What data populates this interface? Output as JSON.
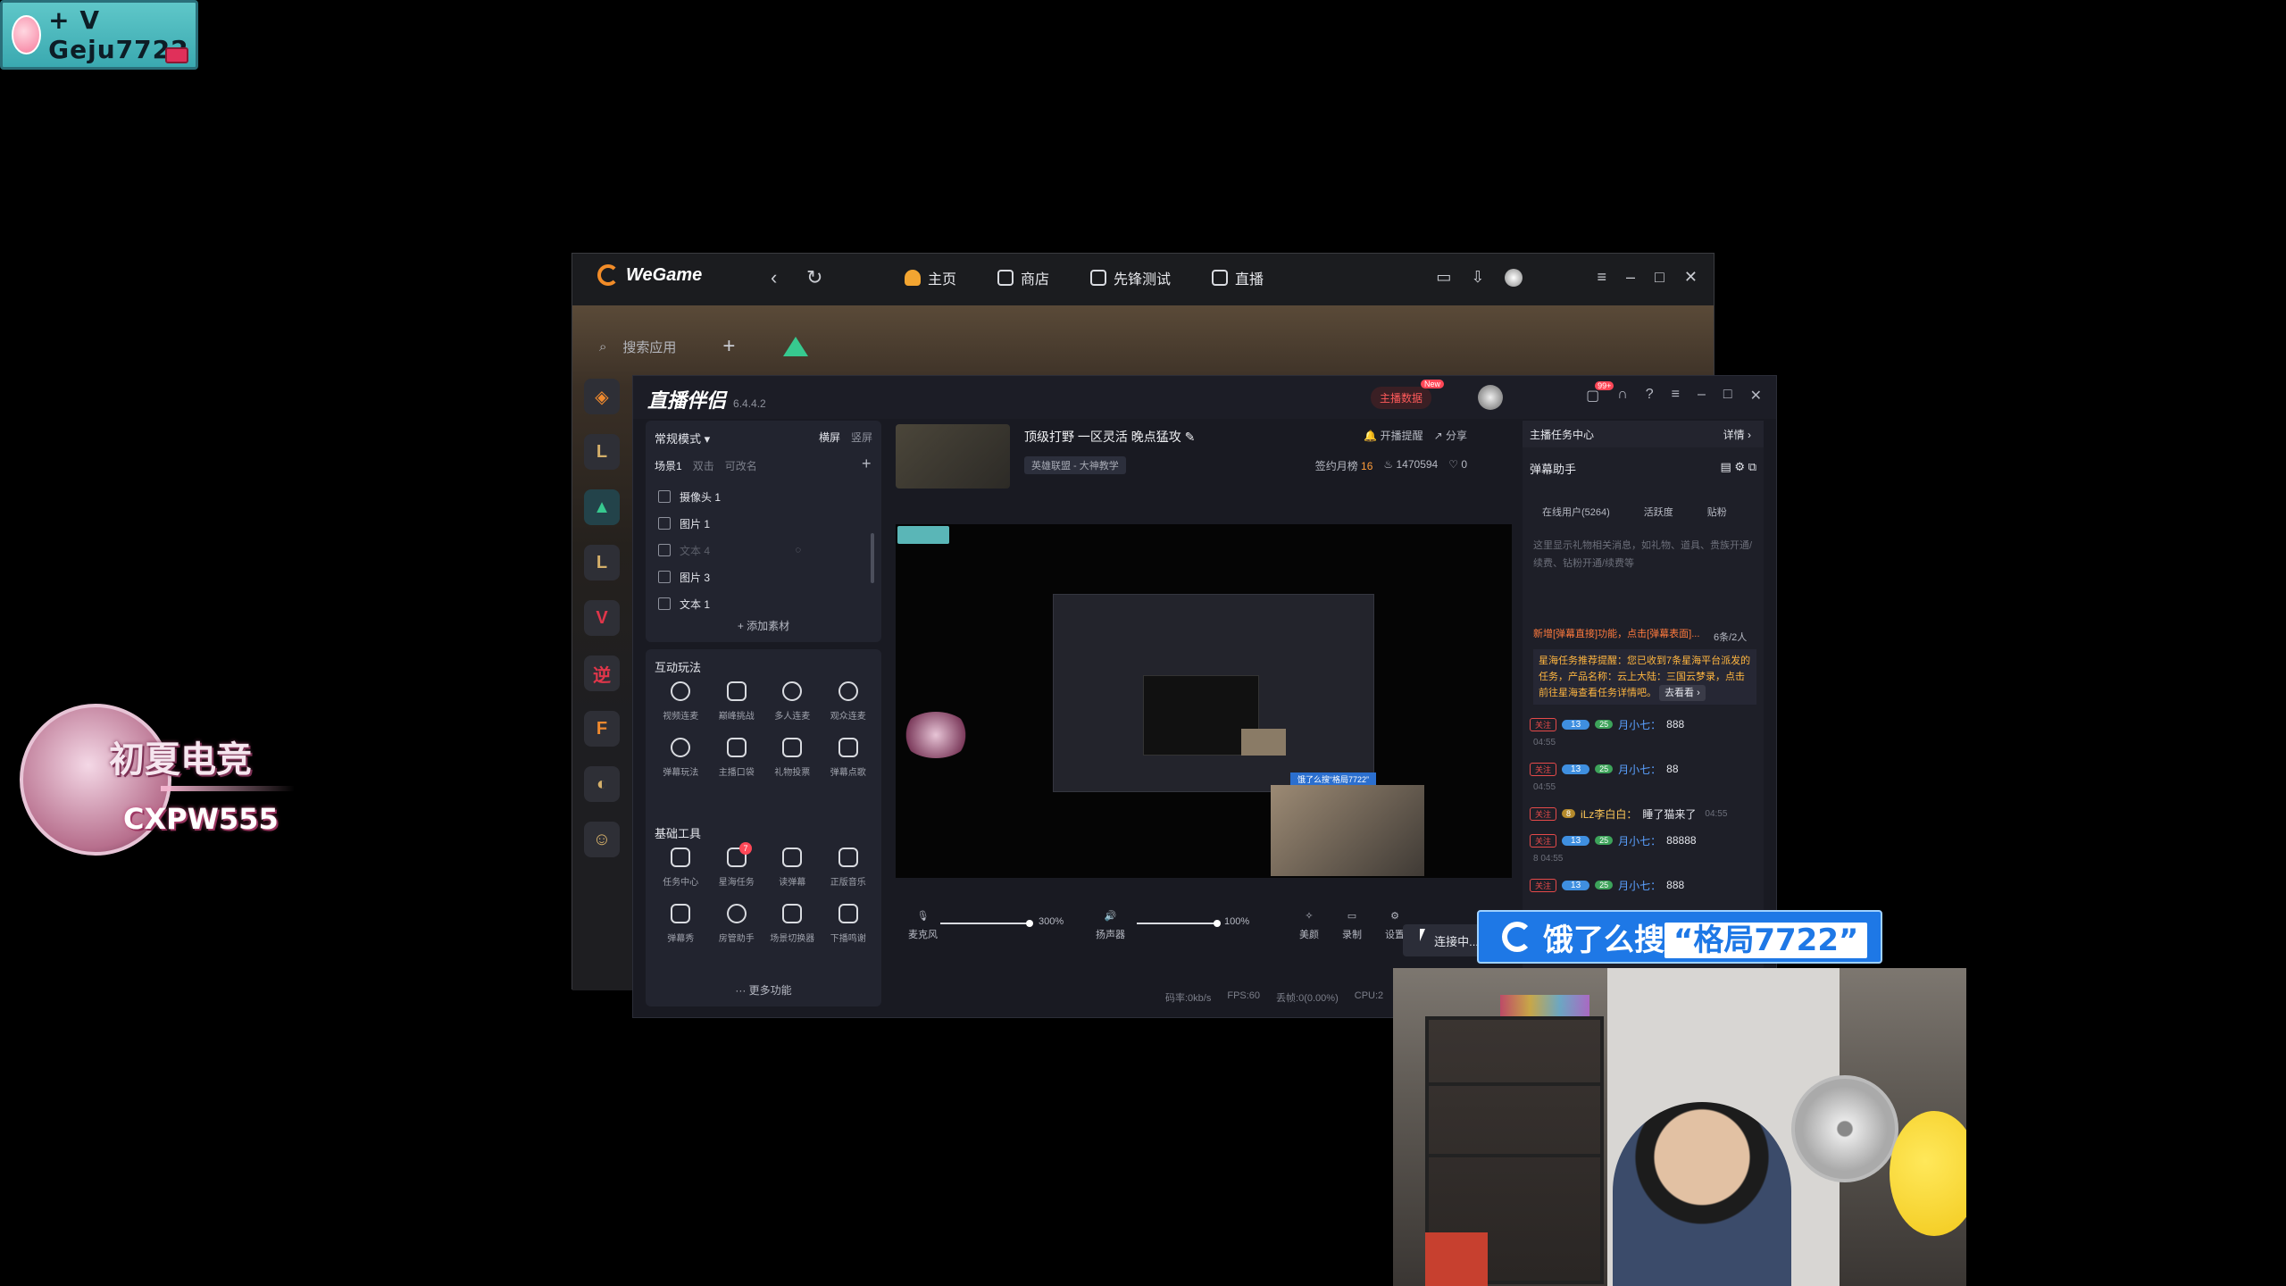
{
  "overlay": {
    "name_badge": "+ V Geju7722",
    "avatar_logo_word1": "初夏电竞",
    "avatar_logo_word2": "CXPW555"
  },
  "wegame": {
    "logo": "WeGame",
    "nav": [
      "主页",
      "商店",
      "先锋测试",
      "直播"
    ],
    "search_placeholder": "搜索应用",
    "side_apps": [
      "app-orange",
      "lol",
      "valorant",
      "lol",
      "red-app",
      "yingxiong",
      "cf",
      "app-gray",
      "app-char"
    ]
  },
  "live_companion": {
    "title": "直播伴侣",
    "version": "6.4.4.2",
    "live_data_btn": "主播数据",
    "new_badge": "New",
    "msg_badge": "99+",
    "scene": {
      "mode": "常规模式",
      "landscape": "横屏",
      "portrait": "竖屏",
      "tab": "场景1",
      "tab_hint1": "双击",
      "tab_hint2": "可改名",
      "items": [
        {
          "label": "摄像头 1",
          "dim": false
        },
        {
          "label": "图片 1",
          "dim": false
        },
        {
          "label": "文本 4",
          "dim": true
        },
        {
          "label": "图片 3",
          "dim": false
        },
        {
          "label": "文本 1",
          "dim": false
        }
      ],
      "add_material": "+ 添加素材"
    },
    "interactive": {
      "title": "互动玩法",
      "tools": [
        "视频连麦",
        "巅峰挑战",
        "多人连麦",
        "观众连麦",
        "弹幕玩法",
        "主播口袋",
        "礼物投票",
        "弹幕点歌"
      ]
    },
    "basic": {
      "title": "基础工具",
      "tools": [
        "任务中心",
        "星海任务",
        "读弹幕",
        "正版音乐",
        "弹幕秀",
        "房管助手",
        "场景切换器",
        "下播鸣谢"
      ],
      "badge": "7",
      "more": "··· 更多功能"
    },
    "stream": {
      "title": "顶级打野 一区灵活 晚点猛攻",
      "tag": "英雄联盟 - 大神教学",
      "notify": "开播提醒",
      "share": "分享",
      "sign": "签约月榜",
      "sign_value": "16",
      "heat": "1470594",
      "likes": "0"
    },
    "preview": {
      "nested_tag": "饿了么搜“格局7722”"
    },
    "audio": {
      "mic_label": "麦克风",
      "mic_value": "300%",
      "speaker_label": "扬声器",
      "speaker_value": "100%",
      "beauty": "美颜",
      "record": "录制",
      "settings": "设置",
      "connect": "连接中..."
    },
    "status": {
      "bitrate": "码率:0kb/s",
      "fps": "FPS:60",
      "drop": "丢帧:0(0.00%)",
      "cpu": "CPU:2"
    },
    "right": {
      "task_center": "主播任务中心",
      "detail": "详情 ›",
      "danmu_title": "弹幕助手",
      "tabs": [
        "在线用户(5264)",
        "活跃度",
        "贴粉"
      ],
      "hint": "这里显示礼物相关消息，如礼物、道具、贵族开通/续费、钻粉开通/续费等",
      "notice": "新增[弹幕直接]功能，点击[弹幕表面]...",
      "count": "6条/2人",
      "card": "星海任务推荐提醒：您已收到7条星海平台派发的任务，产品名称：云上大陆：三国云梦录，点击前往星海查看任务详情吧。",
      "card_btn": "去看看 ›",
      "chats": [
        {
          "follow": "关注",
          "lvl": "13",
          "fan": "25",
          "name": "月小七：",
          "msg": "888",
          "time": "04:55"
        },
        {
          "follow": "关注",
          "lvl": "13",
          "fan": "25",
          "name": "月小七：",
          "msg": "88",
          "time": "04:55"
        },
        {
          "follow": "关注",
          "lvl": "",
          "fan": "8",
          "name": "iLz李白白：",
          "msg": "睡了猫来了",
          "time": "04:55",
          "gold": true
        },
        {
          "follow": "关注",
          "lvl": "13",
          "fan": "25",
          "name": "月小七：",
          "msg": "88888",
          "time": "8 04:55"
        },
        {
          "follow": "关注",
          "lvl": "13",
          "fan": "25",
          "name": "月小七：",
          "msg": "888",
          "time": ""
        }
      ]
    }
  },
  "ad": {
    "prefix": "饿了么搜",
    "keyword": "“格局7722”"
  }
}
